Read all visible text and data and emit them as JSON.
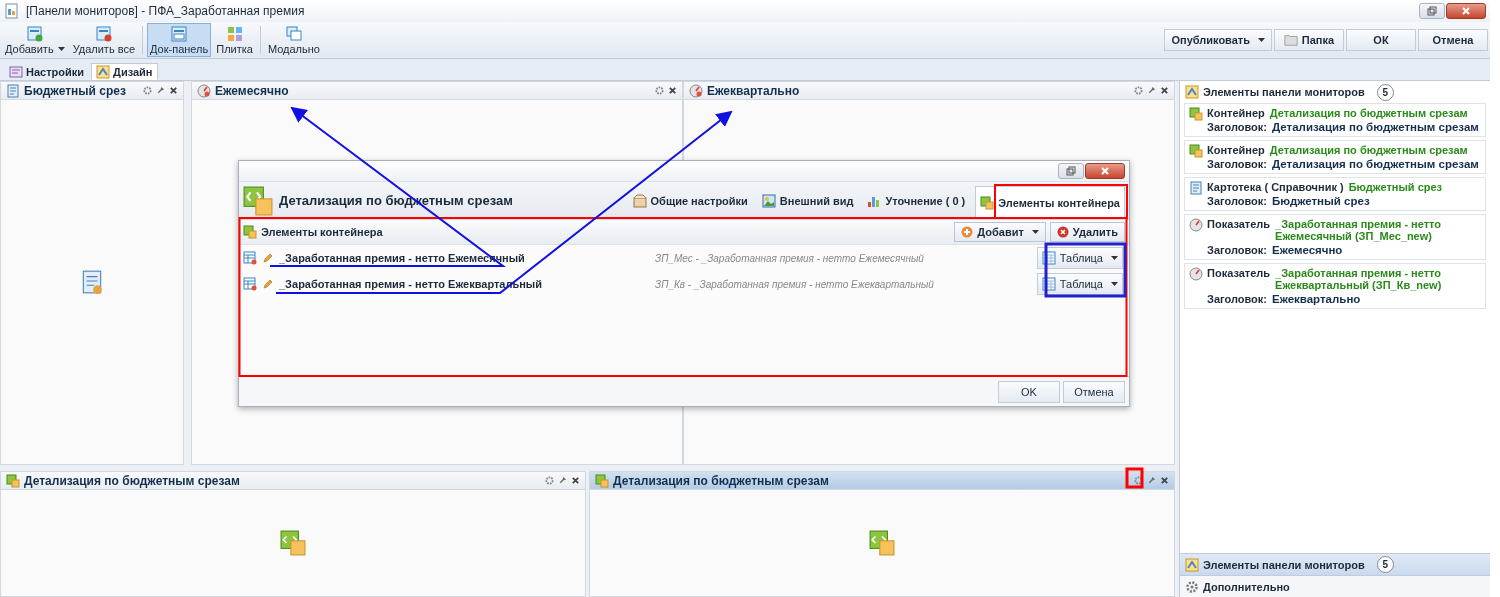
{
  "window": {
    "title": "[Панели мониторов] - ПФА_Заработанная премия"
  },
  "toolbar": {
    "left": [
      {
        "label": "Добавить",
        "kind": "add",
        "dropdown": true,
        "selected": false
      },
      {
        "label": "Удалить все",
        "kind": "remove",
        "dropdown": false,
        "selected": false
      },
      {
        "label": "Док-панель",
        "kind": "dock",
        "dropdown": false,
        "selected": true
      },
      {
        "label": "Плитка",
        "kind": "tile",
        "dropdown": false,
        "selected": false
      },
      {
        "label": "Модально",
        "kind": "modal",
        "dropdown": false,
        "selected": false
      }
    ],
    "right": [
      {
        "label": "Опубликовать",
        "kind": "publish",
        "dropdown": true
      },
      {
        "label": "Папка",
        "kind": "folder",
        "dropdown": false
      },
      {
        "label": "ОК",
        "kind": "plain",
        "dropdown": false
      },
      {
        "label": "Отмена",
        "kind": "plain",
        "dropdown": false
      }
    ]
  },
  "tabs": [
    {
      "label": "Настройки",
      "kind": "settings",
      "selected": false
    },
    {
      "label": "Дизайн",
      "kind": "design",
      "selected": true
    }
  ],
  "panels_top": [
    {
      "title": "Бюджетный срез",
      "kind": "catalog",
      "active": false
    },
    {
      "title": "Ежемесячно",
      "kind": "indicator",
      "active": false
    },
    {
      "title": "Ежеквартально",
      "kind": "indicator",
      "active": false
    }
  ],
  "panels_bottom": [
    {
      "title": "Детализация по бюджетным срезам",
      "kind": "container",
      "active": false
    },
    {
      "title": "Детализация по бюджетным срезам",
      "kind": "container",
      "active": true
    }
  ],
  "dialog": {
    "title": "Детализация по бюджетным срезам",
    "tabs": [
      {
        "label": "Общие настройки",
        "kind": "general",
        "selected": false
      },
      {
        "label": "Внешний вид",
        "kind": "view",
        "selected": false
      },
      {
        "label": "Уточнение ( 0 )",
        "kind": "filter",
        "selected": false
      },
      {
        "label": "Элементы контейнера",
        "kind": "container",
        "selected": true
      }
    ],
    "section_title": "Элементы контейнера",
    "add_button": "Добавит",
    "delete_button": "Удалить",
    "rows": [
      {
        "name": "_Заработанная премия - нетто Ежемесячный",
        "description": "ЗП_Мес - _Заработанная премия - нетто Ежемесячный",
        "view": "Таблица"
      },
      {
        "name": "_Заработанная премия - нетто Ежеквартальный",
        "description": "ЗП_Кв - _Заработанная премия - нетто Ежеквартальный",
        "view": "Таблица"
      }
    ],
    "buttons": [
      "OK",
      "Отмена"
    ]
  },
  "sidebar": {
    "title": "Элементы панели мониторов",
    "count": "5",
    "items": [
      {
        "kind": "container",
        "type_label": "Контейнер",
        "value": "Детализация по бюджетным срезам",
        "caption_label": "Заголовок:",
        "caption": "Детализация по бюджетным срезам"
      },
      {
        "kind": "container",
        "type_label": "Контейнер",
        "value": "Детализация по бюджетным срезам",
        "caption_label": "Заголовок:",
        "caption": "Детализация по бюджетным срезам"
      },
      {
        "kind": "catalog",
        "type_label": "Картотека ( Справочник )",
        "value": "Бюджетный срез",
        "caption_label": "Заголовок:",
        "caption": "Бюджетный срез"
      },
      {
        "kind": "indicator",
        "type_label": "Показатель",
        "value": "_Заработанная премия - нетто Ежемесячный (ЗП_Мес_new)",
        "caption_label": "Заголовок:",
        "caption": "Ежемесячно"
      },
      {
        "kind": "indicator",
        "type_label": "Показатель",
        "value": "_Заработанная премия - нетто Ежеквартальный (ЗП_Кв_new)",
        "caption_label": "Заголовок:",
        "caption": "Ежеквартально"
      }
    ],
    "sections": [
      {
        "label": "Элементы панели мониторов",
        "count": "5",
        "kind": "elements",
        "selected": true
      },
      {
        "label": "Дополнительно",
        "kind": "gear",
        "selected": false
      }
    ]
  }
}
